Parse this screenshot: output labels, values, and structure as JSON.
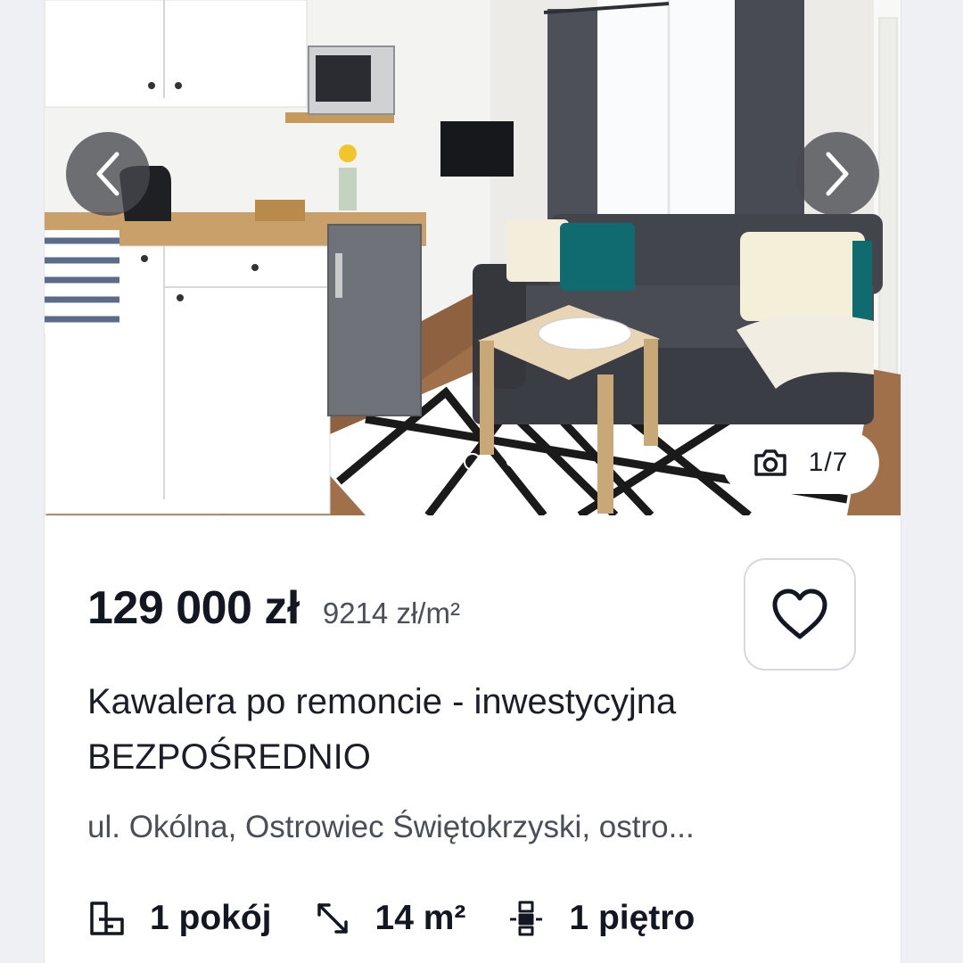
{
  "gallery": {
    "prev_icon": "chevron-left-icon",
    "next_icon": "chevron-right-icon",
    "counter_icon": "camera-icon",
    "counter": "1/7",
    "watermark": "dom",
    "current_slide": 1,
    "total_slides": 7
  },
  "listing": {
    "price": "129 000 zł",
    "price_per_m2": "9214 zł/m²",
    "favorite_icon": "heart-outline-icon",
    "title": "Kawalera po remoncie - inwestycyjna BEZPOŚREDNIO",
    "address": "ul. Okólna, Ostrowiec Świętokrzyski, ostro...",
    "features": [
      {
        "icon": "rooms-icon",
        "label": "1 pokój"
      },
      {
        "icon": "area-icon",
        "label": "14 m²"
      },
      {
        "icon": "floor-icon",
        "label": "1 piętro"
      }
    ]
  },
  "colors": {
    "page_bg": "#eef0f3",
    "card_bg": "#ffffff",
    "text_primary": "#131722",
    "text_secondary": "#4a4e57"
  }
}
